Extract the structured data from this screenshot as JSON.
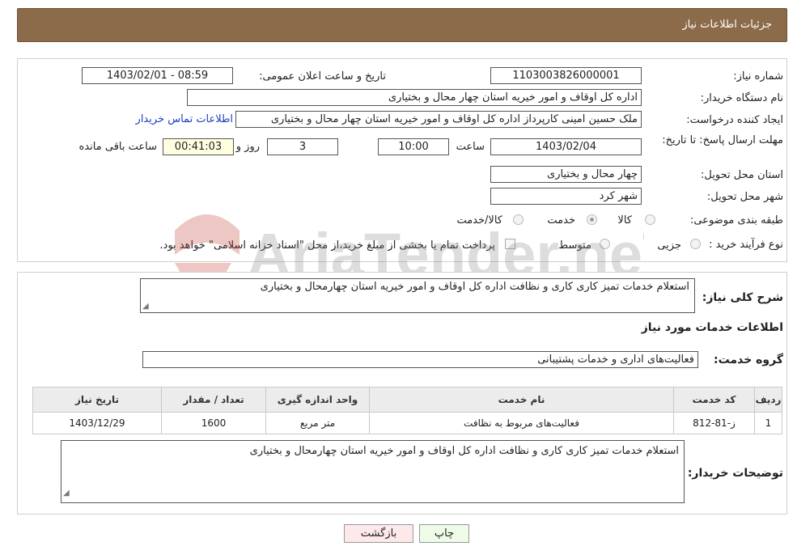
{
  "header": {
    "title": "جزئیات اطلاعات نیاز"
  },
  "fields": {
    "need_number_label": "شماره نیاز:",
    "need_number": "1103003826000001",
    "announce_label": "تاریخ و ساعت اعلان عمومی:",
    "announce_value": "1403/02/01 - 08:59",
    "buyer_org_label": "نام دستگاه خریدار:",
    "buyer_org": "اداره کل اوقاف و امور خیریه استان چهار محال و بختیاری",
    "creator_label": "ایجاد کننده درخواست:",
    "creator": "ملک حسین امینی کارپرداز اداره کل اوقاف و امور خیریه استان چهار محال و بختیاری",
    "contact_link": "اطلاعات تماس خریدار",
    "deadline_label": "مهلت ارسال پاسخ: تا تاریخ:",
    "deadline_date": "1403/02/04",
    "time_label": "ساعت",
    "deadline_time": "10:00",
    "days_value": "3",
    "days_label": "روز و",
    "remaining_time": "00:41:03",
    "remaining_label": "ساعت باقی مانده",
    "province_label": "استان محل تحویل:",
    "province": "چهار محال و بختیاری",
    "city_label": "شهر محل تحویل:",
    "city": "شهر کرد",
    "category_label": "طبقه بندی موضوعی:",
    "category_options": [
      "کالا",
      "خدمت",
      "کالا/خدمت"
    ],
    "category_selected": 1,
    "purchase_label": "نوع فرآیند خرید :",
    "purchase_options": [
      "جزیی",
      "متوسط"
    ],
    "purchase_note": "پرداخت تمام یا بخشی از مبلغ خرید،از محل \"اسناد خزانه اسلامی\" خواهد بود."
  },
  "details": {
    "summary_label": "شرح کلی نیاز:",
    "summary_text": "استعلام خدمات تمیز کاری کاری و نظافت اداره کل اوقاف و امور خیریه استان چهارمحال و بختیاری",
    "services_heading": "اطلاعات خدمات مورد نیاز",
    "group_label": "گروه خدمت:",
    "group_value": "فعالیت‌های اداری و خدمات پشتیبانی",
    "table": {
      "headers": [
        "ردیف",
        "کد خدمت",
        "نام خدمت",
        "واحد اندازه گیری",
        "تعداد / مقدار",
        "تاریخ نیاز"
      ],
      "rows": [
        [
          "1",
          "ز-81-812",
          "فعالیت‌های مربوط به نظافت",
          "متر مربع",
          "1600",
          "1403/12/29"
        ]
      ]
    },
    "notes_label": "توضیحات خریدار:",
    "notes_text": "استعلام خدمات تمیز کاری کاری و نظافت اداره کل اوقاف و امور خیریه استان چهارمحال و بختیاری"
  },
  "buttons": {
    "print": "چاپ",
    "back": "بازگشت"
  },
  "watermark": {
    "text": "AriaTender.neT"
  },
  "colors": {
    "header_bg": "#8b6b4a",
    "link": "#1a3fc4",
    "print_bg": "#eefbe6",
    "back_bg": "#fde8ea"
  }
}
